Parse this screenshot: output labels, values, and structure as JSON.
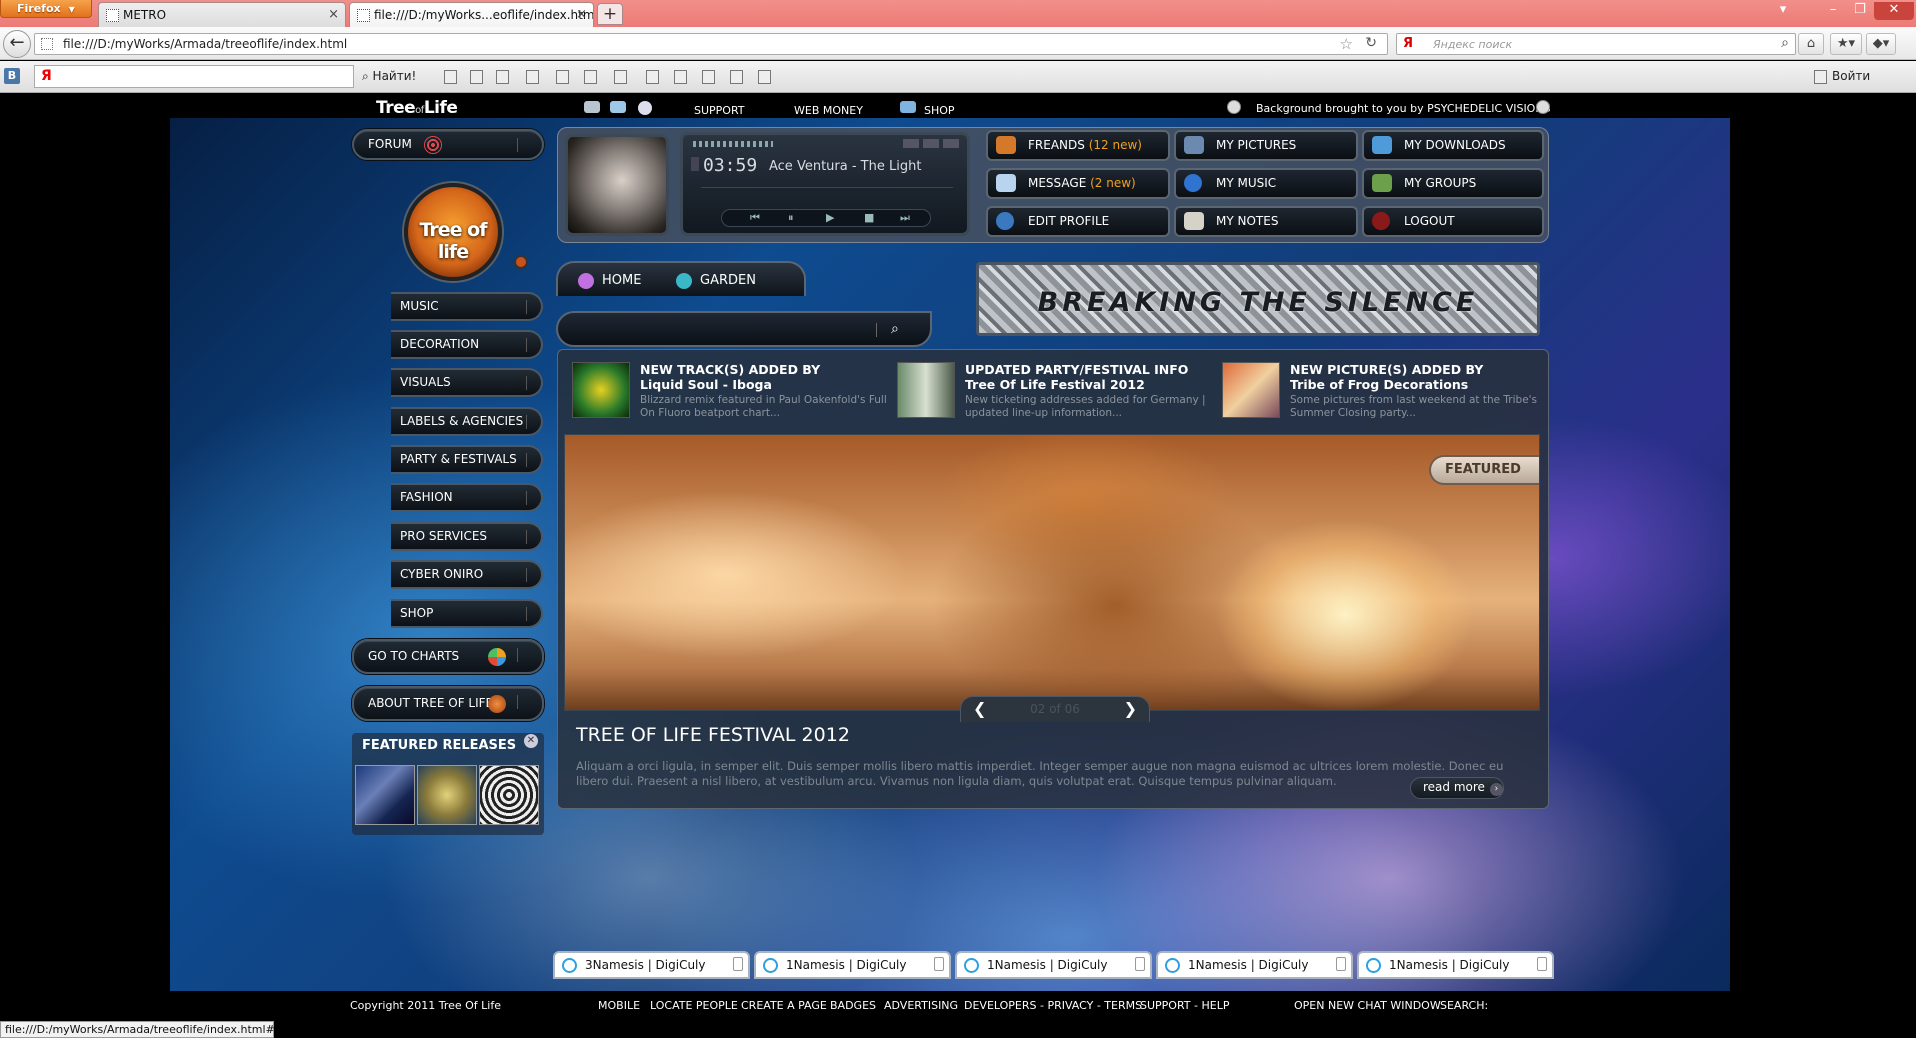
{
  "browser": {
    "menu_label": "Firefox",
    "tabs": [
      {
        "title": "METRO"
      },
      {
        "title": "file:///D:/myWorks...eoflife/index.html"
      }
    ],
    "new_tab": "+",
    "url": "file:///D:/myWorks/Armada/treeoflife/index.html",
    "search_placeholder": "Яндекс поиск",
    "search_engine": "Я",
    "find_label": "Найти!",
    "login_label": "Войти",
    "status_text": "file:///D:/myWorks/Armada/treeoflife/index.html#"
  },
  "site": {
    "logo": "Tree",
    "logo_of": "of",
    "logo_life": "Life",
    "top_nav": [
      "SUPPORT",
      "WEB MONEY",
      "SHOP"
    ],
    "bg_credit": "Background brought to you by PSYCHEDELIC VISIONS",
    "forum_label": "FORUM",
    "circle_logo": "Tree of life",
    "menu": [
      "MUSIC",
      "DECORATION",
      "VISUALS",
      "LABELS & AGENCIES",
      "PARTY & FESTIVALS",
      "FASHION",
      "PRO SERVICES",
      "CYBER ONIRO",
      "SHOP"
    ],
    "charts_label": "GO TO CHARTS",
    "about_label": "ABOUT TREE OF LIFE",
    "featured_releases": "FEATURED RELEASES",
    "player": {
      "time": "03:59",
      "track": "Ace Ventura - The Light"
    },
    "quick": [
      {
        "label": "FREANDS",
        "new": "(12 new)"
      },
      {
        "label": "MY PICTURES",
        "new": ""
      },
      {
        "label": "MY DOWNLOADS",
        "new": ""
      },
      {
        "label": "MESSAGE",
        "new": "(2 new)"
      },
      {
        "label": "MY MUSIC",
        "new": ""
      },
      {
        "label": "MY GROUPS",
        "new": ""
      },
      {
        "label": "EDIT PROFILE",
        "new": ""
      },
      {
        "label": "MY NOTES",
        "new": ""
      },
      {
        "label": "LOGOUT",
        "new": ""
      }
    ],
    "home_nav": [
      "HOME",
      "GARDEN"
    ],
    "banner_text": "BREAKING THE SILENCE",
    "news": [
      {
        "title1": "NEW TRACK(S) ADDED BY",
        "title2": "Liquid Soul - Iboga",
        "desc": "Blizzard remix featured in Paul Oakenfold's Full On Fluoro beatport chart..."
      },
      {
        "title1": "UPDATED PARTY/FESTIVAL INFO",
        "title2": "Tree Of Life Festival 2012",
        "desc": "New ticketing addresses added for Germany | updated line-up information..."
      },
      {
        "title1": "NEW PICTURE(S) ADDED BY",
        "title2": "Tribe of Frog Decorations",
        "desc": "Some pictures from last weekend at the Tribe's Summer Closing party..."
      }
    ],
    "featured_label": "FEATURED",
    "pager": {
      "prev": "❮",
      "next": "❯",
      "count": "02 of 06"
    },
    "hero_title": "TREE OF LIFE FESTIVAL 2012",
    "hero_text": "Aliquam a orci ligula, in semper elit. Duis semper mollis libero mattis imperdiet. Integer semper augue non magna euismod ac ultrices lorem molestie. Donec eu libero dui. Praesent a nisl libero, at vestibulum arcu. Vivamus non ligula diam, quis volutpat erat. Quisque tempus pulvinar aliquam.",
    "read_more": "read more",
    "chats": [
      "3Namesis | DigiCuly",
      "1Namesis | DigiCuly",
      "1Namesis | DigiCuly",
      "1Namesis | DigiCuly",
      "1Namesis | DigiCuly"
    ],
    "copyright": "Copyright 2011 Tree Of Life",
    "footer_links": [
      "MOBILE",
      "LOCATE PEOPLE",
      "CREATE A PAGE",
      "BADGES",
      "ADVERTISING",
      "DEVELOPERS - PRIVACY - TERMS",
      "SUPPORT - HELP"
    ],
    "chat_window": "OPEN NEW CHAT WINDOW",
    "footer_search": "SEARCH:"
  }
}
